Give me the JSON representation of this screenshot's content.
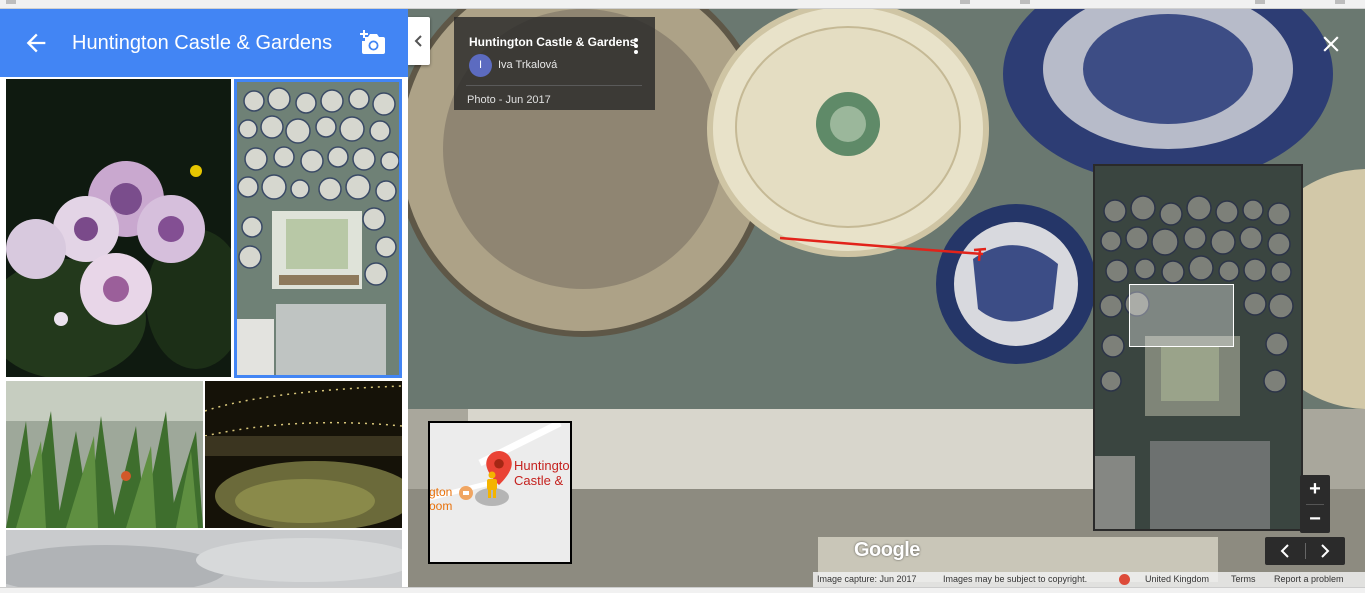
{
  "header": {
    "title": "Huntington Castle & Gardens"
  },
  "info_card": {
    "place_name": "Huntington Castle & Gardens",
    "author_initial": "I",
    "author_name": "Iva Trkalová",
    "photo_date": "Photo - Jun 2017"
  },
  "minimap": {
    "place_label_line1": "Huntington",
    "place_label_line2": "Castle &",
    "cafe_label_line1": "gton",
    "cafe_label_line2": "oom"
  },
  "zoom": {
    "in_label": "+",
    "out_label": "−"
  },
  "watermark": "Google",
  "footer": {
    "capture": "Image capture: Jun 2017",
    "copyright": "Images may be subject to copyright.",
    "region": "United Kingdom",
    "terms": "Terms",
    "report": "Report a problem"
  },
  "icons": {
    "back": "arrow-left-icon",
    "camera": "add-photo-icon",
    "collapse": "chevron-left-icon",
    "close": "close-icon",
    "more": "more-vert-icon",
    "prev": "chevron-left-icon",
    "next": "chevron-right-icon"
  },
  "colors": {
    "header": "#4285f4",
    "selected_outline": "#4285f4",
    "pin": "#ea4335"
  }
}
